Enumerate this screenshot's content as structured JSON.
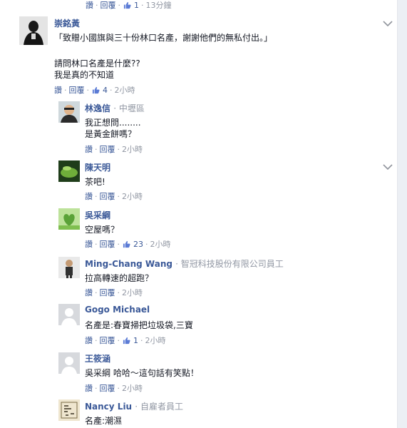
{
  "labels": {
    "like": "讚",
    "reply": "回覆",
    "separator": "·"
  },
  "top_row": {
    "like_count": "1",
    "time": "13分鐘"
  },
  "post": {
    "author": "崇銘黃",
    "lines": [
      "「致贈小國旗與三十份林口名產，謝謝他們的無私付出。」",
      "",
      "請問林口名產是什麼??",
      "我是真的不知道"
    ],
    "like_count": "4",
    "time": "2小時"
  },
  "replies": [
    {
      "author": "林逸信",
      "meta": "中壢區",
      "lines": [
        "我正想問........",
        "是黃金餅嗎？"
      ],
      "like_count": "",
      "time": "2小時"
    },
    {
      "author": "陳天明",
      "meta": "",
      "lines": [
        "茶吧!"
      ],
      "like_count": "",
      "time": "2小時"
    },
    {
      "author": "吳采綱",
      "meta": "",
      "lines": [
        "空屋嗎？"
      ],
      "like_count": "23",
      "time": "2小時"
    },
    {
      "author": "Ming-Chang Wang",
      "meta": "智冠科技股份有限公司員工",
      "lines": [
        "拉高轉速的超跑？"
      ],
      "like_count": "",
      "time": "2小時"
    },
    {
      "author": "Gogo Michael",
      "meta": "",
      "lines": [
        "名產是:春寶掃把垃圾袋,三寶"
      ],
      "like_count": "1",
      "time": "2小時"
    },
    {
      "author": "王筱涵",
      "meta": "",
      "lines": [
        "吳采綱 哈哈～這句話有笑點！"
      ],
      "like_count": "",
      "time": "2小時"
    },
    {
      "author": "Nancy Liu",
      "meta": "自雇者員工",
      "lines": [
        "名產:潮濕"
      ],
      "like_count": "",
      "time": ""
    }
  ],
  "colors": {
    "link": "#3b5998",
    "muted": "#9197a3",
    "text": "#141823"
  }
}
